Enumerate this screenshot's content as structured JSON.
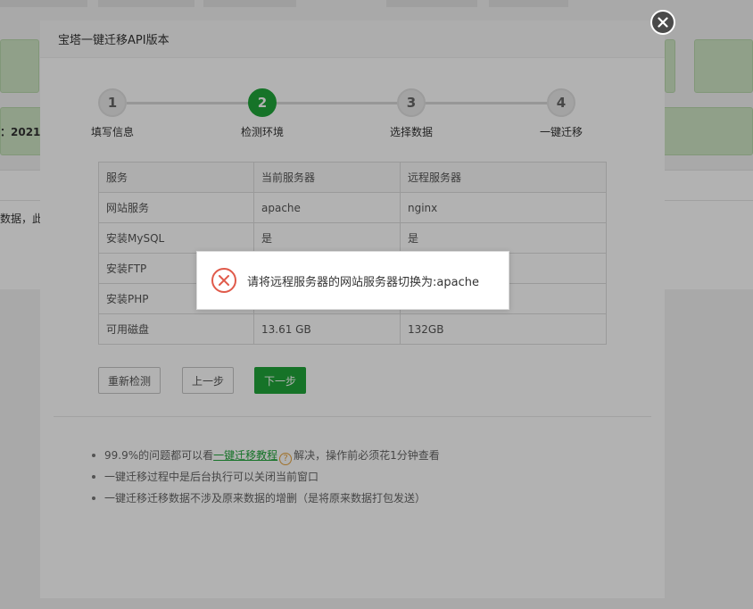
{
  "background": {
    "version_fragment": "：2021",
    "strip_text": "数据，此"
  },
  "dialog": {
    "title": "宝塔一键迁移API版本",
    "close_icon": "close-icon",
    "steps": [
      {
        "number": "1",
        "label": "填写信息",
        "active": false
      },
      {
        "number": "2",
        "label": "检测环境",
        "active": true
      },
      {
        "number": "3",
        "label": "选择数据",
        "active": false
      },
      {
        "number": "4",
        "label": "一键迁移",
        "active": false
      }
    ],
    "table": {
      "headers": [
        "服务",
        "当前服务器",
        "远程服务器"
      ],
      "rows": [
        [
          "网站服务",
          "apache",
          "nginx"
        ],
        [
          "安装MySQL",
          "是",
          "是"
        ],
        [
          "安装FTP",
          "",
          ""
        ],
        [
          "安装PHP",
          "",
          ""
        ],
        [
          "可用磁盘",
          "13.61 GB",
          "132GB"
        ]
      ]
    },
    "buttons": {
      "recheck": "重新检测",
      "prev": "上一步",
      "next": "下一步"
    },
    "tips": {
      "tip1_before": "99.9%的问题都可以看",
      "tip1_link": "一键迁移教程",
      "tip1_help": "?",
      "tip1_after": "解决，操作前必须花1分钟查看",
      "tip2": "一键迁移过程中是后台执行可以关闭当前窗口",
      "tip3": "一键迁移迁移数据不涉及原来数据的增删（是将原来数据打包发送）"
    }
  },
  "toast": {
    "icon": "error-circle-icon",
    "message": "请将远程服务器的网站服务器切换为:apache",
    "icon_color": "#e05a4a"
  },
  "colors": {
    "accent": "#20a53a",
    "overlay": "rgba(0,0,0,0.30)"
  }
}
